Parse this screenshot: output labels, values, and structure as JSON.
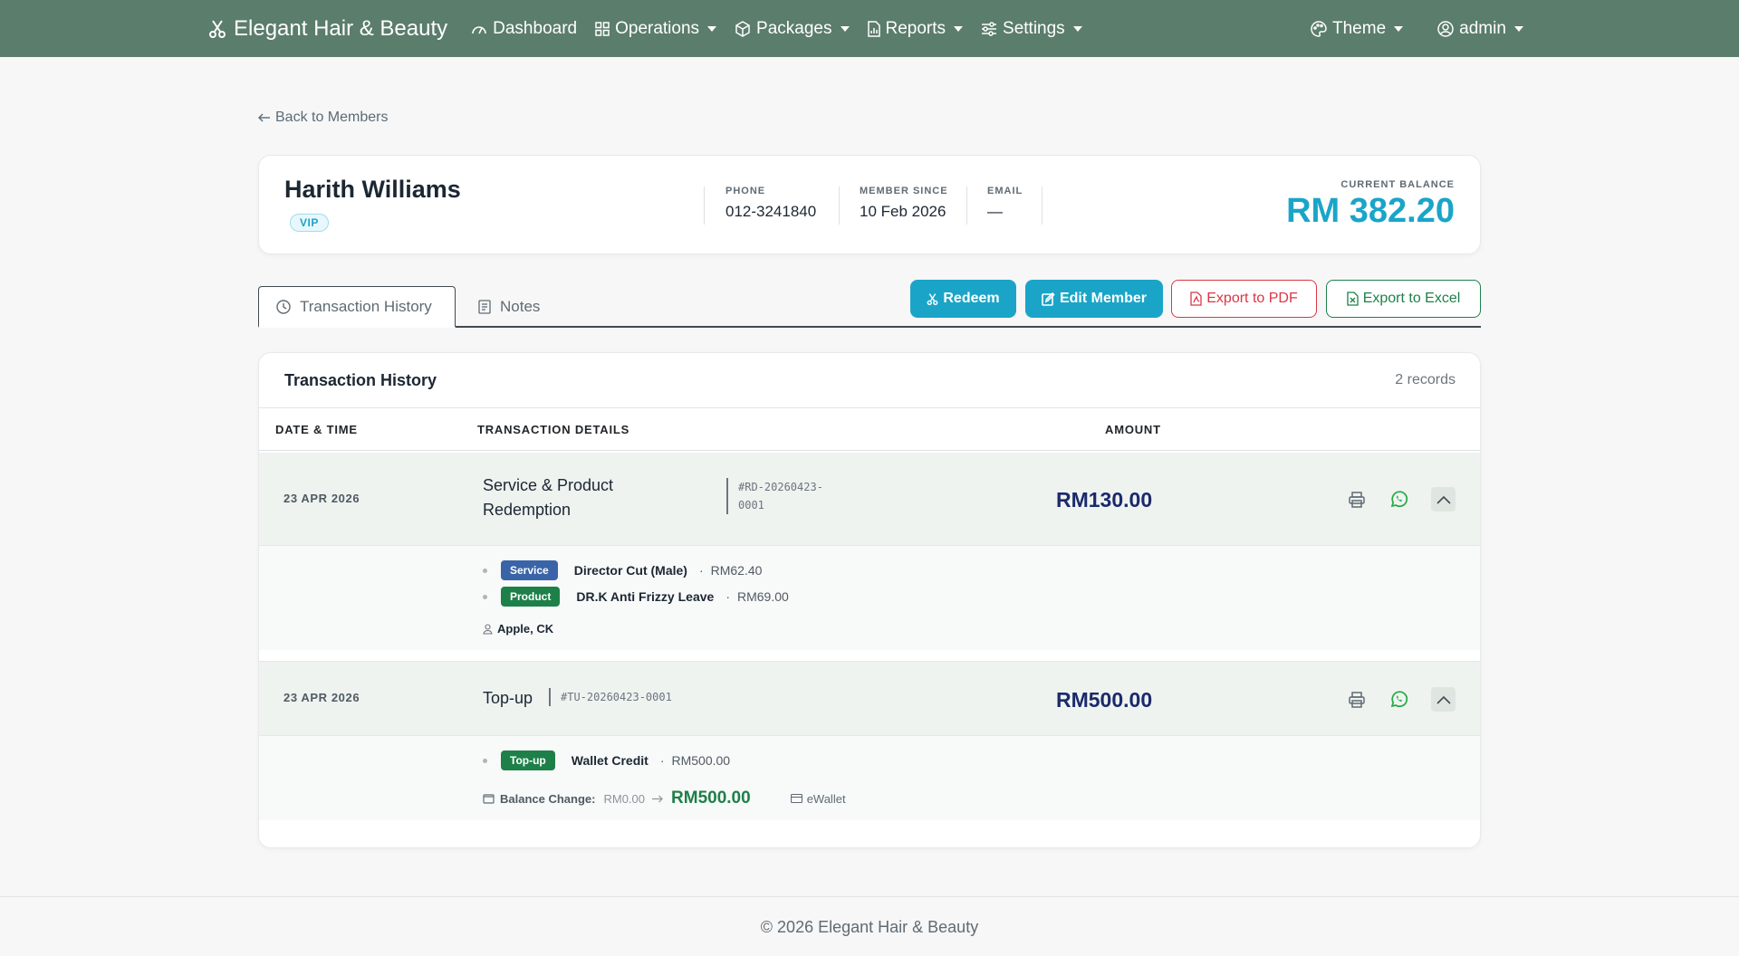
{
  "nav": {
    "brand": "Elegant Hair & Beauty",
    "items": [
      {
        "label": "Dashboard"
      },
      {
        "label": "Operations"
      },
      {
        "label": "Packages"
      },
      {
        "label": "Reports"
      },
      {
        "label": "Settings"
      }
    ],
    "theme": "Theme",
    "user": "admin"
  },
  "back_label": "Back to Members",
  "member": {
    "name": "Harith Williams",
    "tier": "VIP",
    "phone_label": "PHONE",
    "phone": "012-3241840",
    "since_label": "MEMBER SINCE",
    "since": "10 Feb 2026",
    "email_label": "EMAIL",
    "email": "—",
    "balance_label": "CURRENT BALANCE",
    "balance": "RM 382.20"
  },
  "tabs": {
    "history": "Transaction History",
    "notes": "Notes"
  },
  "actions": {
    "redeem": "Redeem",
    "edit": "Edit Member",
    "pdf": "Export to PDF",
    "excel": "Export to Excel"
  },
  "colors": {
    "navbar": "#5b7d6c",
    "accent": "#1aa5c8",
    "redemption_accent": "#3a64a8",
    "topup_accent": "#1e8049"
  },
  "transactions": {
    "title": "Transaction History",
    "count": "2 records",
    "columns": {
      "date": "DATE & TIME",
      "details": "TRANSACTION DETAILS",
      "amount": "AMOUNT"
    },
    "rows": [
      {
        "date": "23 APR 2026",
        "title_line1": "Service & Product",
        "title_line2": "Redemption",
        "ref_line1": "#RD-20260423-",
        "ref_line2": "0001",
        "amount": "RM130.00",
        "items": [
          {
            "type": "Service",
            "name": "Director Cut (Male)",
            "sep": "·",
            "price": "RM62.40"
          },
          {
            "type": "Product",
            "name": "DR.K Anti Frizzy Leave",
            "sep": "·",
            "price": "RM69.00"
          }
        ],
        "staff": "Apple, CK"
      },
      {
        "date": "23 APR 2026",
        "title": "Top-up",
        "ref": "#TU-20260423-0001",
        "amount": "RM500.00",
        "items": [
          {
            "type": "Top-up",
            "name": "Wallet Credit",
            "sep": "·",
            "price": "RM500.00"
          }
        ],
        "balance_change": {
          "label": "Balance Change:",
          "from": "RM0.00",
          "to": "RM500.00",
          "method": "eWallet"
        }
      }
    ]
  },
  "footer": "© 2026 Elegant Hair & Beauty"
}
